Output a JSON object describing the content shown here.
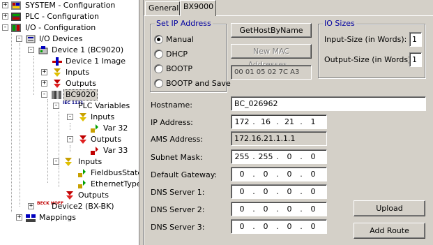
{
  "tree": {
    "items": [
      {
        "label": "SYSTEM - Configuration",
        "icon": "system-config-icon",
        "toggle": "+"
      },
      {
        "label": "PLC - Configuration",
        "icon": "plc-config-icon",
        "toggle": "+"
      },
      {
        "label": "I/O - Configuration",
        "icon": "io-config-icon",
        "toggle": "-"
      },
      {
        "label": "I/O Devices",
        "icon": "io-devices-icon",
        "toggle": "-"
      },
      {
        "label": "Device 1 (BC9020)",
        "icon": "device-icon",
        "toggle": "-"
      },
      {
        "label": "Device 1 Image",
        "icon": "device-image-icon",
        "toggle": ""
      },
      {
        "label": "Inputs",
        "icon": "inputs-icon",
        "toggle": "+"
      },
      {
        "label": "Outputs",
        "icon": "outputs-icon",
        "toggle": "+"
      },
      {
        "label": "BC9020",
        "icon": "bus-coupler-icon",
        "toggle": "-"
      },
      {
        "label": "PLC Variables",
        "icon": "iec-icon",
        "icon_text": "IEC 1131",
        "toggle": "-"
      },
      {
        "label": "Inputs",
        "icon": "inputs-icon",
        "toggle": "-"
      },
      {
        "label": "Var 32",
        "icon": "variable-input-icon",
        "toggle": ""
      },
      {
        "label": "Outputs",
        "icon": "outputs-icon",
        "toggle": "-"
      },
      {
        "label": "Var 33",
        "icon": "variable-output-icon",
        "toggle": ""
      },
      {
        "label": "Inputs",
        "icon": "inputs-icon",
        "toggle": "-"
      },
      {
        "label": "FieldbusState",
        "icon": "variable-input-icon",
        "toggle": ""
      },
      {
        "label": "EthernetType",
        "icon": "variable-input-icon",
        "toggle": ""
      },
      {
        "label": "Outputs",
        "icon": "outputs-icon",
        "toggle": ""
      },
      {
        "label": "Device2 (BX-BK)",
        "icon": "beckhoff-icon",
        "icon_text": "BECK HOFF",
        "toggle": "+"
      },
      {
        "label": "Mappings",
        "icon": "mappings-icon",
        "toggle": "+"
      }
    ]
  },
  "tabs": [
    {
      "label": "General"
    },
    {
      "label": "BX9000"
    }
  ],
  "ip_group": {
    "title": "Set IP Address",
    "options": [
      "Manual",
      "DHCP",
      "BOOTP",
      "BOOTP and Save"
    ],
    "selected": "Manual"
  },
  "buttons": {
    "get_host": "GetHostByName",
    "new_mac": "New MAC Addresses...",
    "upload": "Upload",
    "add_route": "Add Route"
  },
  "mac_value": "00 01 05 02 7C A3",
  "io_sizes": {
    "title": "IO Sizes",
    "input_label": "Input-Size (in Words):",
    "input_value": "1",
    "output_label": "Output-Size (in Words):",
    "output_value": "1"
  },
  "form": {
    "hostname_label": "Hostname:",
    "hostname_value": "BC_026962",
    "ip_label": "IP Address:",
    "ip_octets": [
      "172",
      "16",
      "21",
      "1"
    ],
    "ams_label": "AMS Address:",
    "ams_value": "172.16.21.1.1.1",
    "subnet_label": "Subnet Mask:",
    "subnet_octets": [
      "255",
      "255",
      "0",
      "0"
    ],
    "gateway_label": "Default Gateway:",
    "gateway_octets": [
      "0",
      "0",
      "0",
      "0"
    ],
    "dns1_label": "DNS Server 1:",
    "dns1_octets": [
      "0",
      "0",
      "0",
      "0"
    ],
    "dns2_label": "DNS Server 2:",
    "dns2_octets": [
      "0",
      "0",
      "0",
      "0"
    ],
    "dns3_label": "DNS Server 3:",
    "dns3_octets": [
      "0",
      "0",
      "0",
      "0"
    ],
    "ip_separator": "."
  },
  "colors": {
    "window_bg": "#d4d0c8",
    "group_title": "#0000a0",
    "input_icon": "#c8a000",
    "output_icon": "#c00000"
  }
}
